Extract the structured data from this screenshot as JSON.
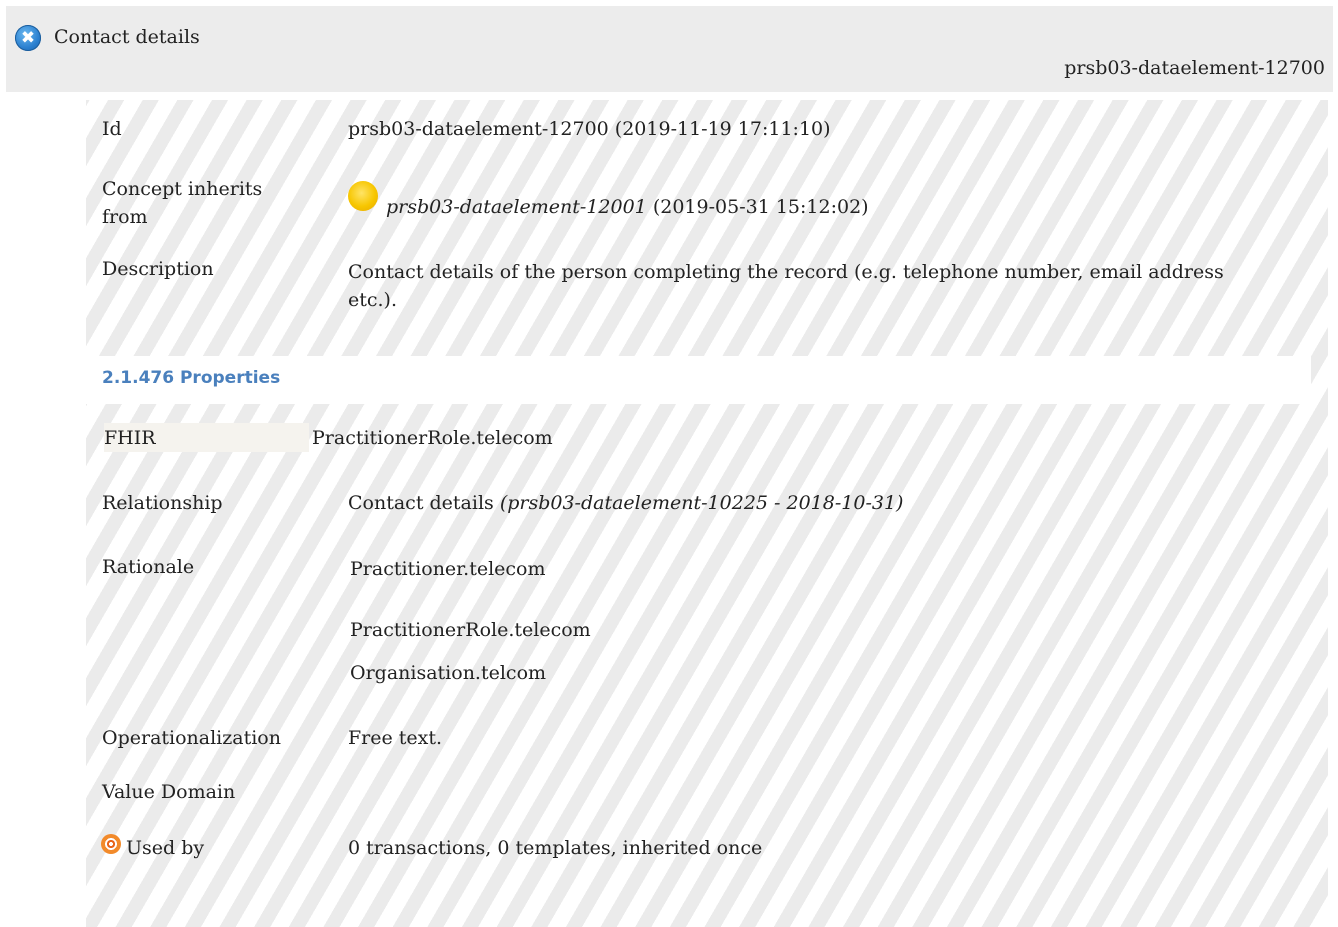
{
  "header": {
    "title": "Contact details",
    "id": "prsb03-dataelement-12700",
    "close_icon": "✖"
  },
  "rows": {
    "id_label": "Id",
    "id_value": "prsb03-dataelement-12700 (2019-11-19 17:11:10)",
    "concept_label": "Concept inherits from",
    "concept_ref": "prsb03-dataelement-12001",
    "concept_date": "(2019-05-31 15:12:02)",
    "description_label": "Description",
    "description_value": "Contact details of the person completing the record (e.g. telephone number, email address etc.)."
  },
  "properties": {
    "section_title": "2.1.476 Properties",
    "fhir_label": "FHIR",
    "fhir_value": "PractitionerRole.telecom",
    "relationship_label": "Relationship",
    "relationship_value": "Contact details",
    "relationship_ref": "(prsb03-dataelement-10225 - 2018-10-31)",
    "rationale_label": "Rationale",
    "rationale_values": [
      "Practitioner.telecom",
      "PractitionerRole.telecom",
      "Organisation.telcom"
    ],
    "operationalization_label": "Operationalization",
    "operationalization_value": "Free text.",
    "value_domain_label": "Value Domain",
    "used_by_label": "Used by",
    "used_by_value": "0 transactions, 0 templates, inherited once"
  },
  "colors": {
    "header_bg": "#ececec",
    "section_title": "#4a80bd",
    "stripe": "#ebebeb",
    "status_dot": "#f7c600"
  }
}
